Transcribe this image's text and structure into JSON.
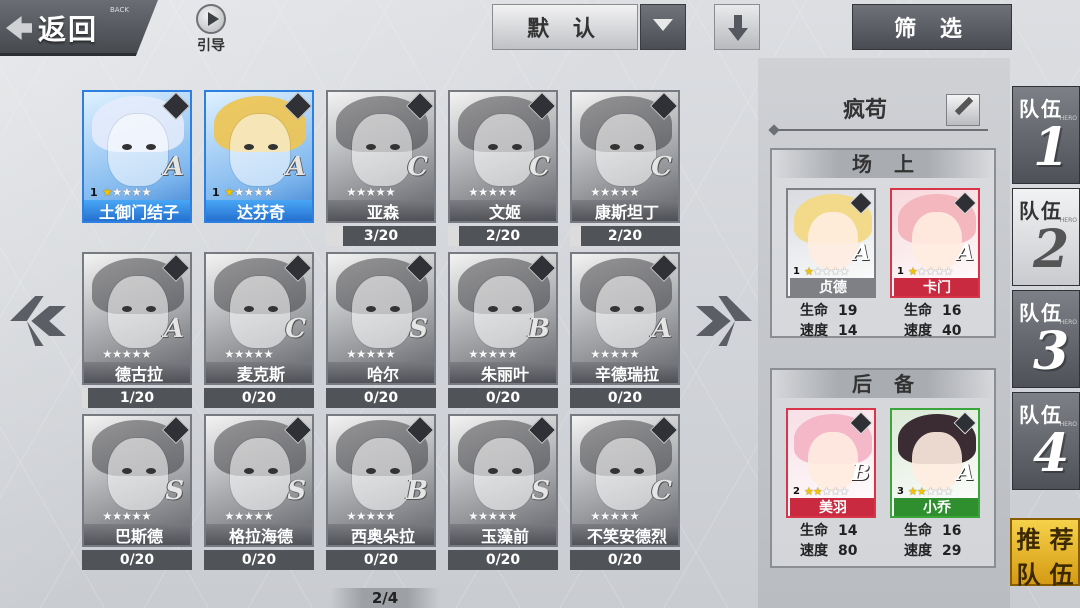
{
  "topbar": {
    "back_label": "返回",
    "back_sub": "BACK",
    "guide_label": "引导",
    "sort_label": "默 认",
    "filter_label": "筛 选"
  },
  "grid": {
    "page_indicator": "2/4",
    "cards": [
      {
        "name": "土御门结子",
        "level": "1",
        "stars": 1,
        "rank": "A",
        "owned": true,
        "hair": "silver",
        "fragments": ""
      },
      {
        "name": "达芬奇",
        "level": "1",
        "stars": 1,
        "rank": "A",
        "owned": true,
        "hair": "gold",
        "fragments": ""
      },
      {
        "name": "亚森",
        "level": "",
        "stars": 0,
        "rank": "C",
        "owned": false,
        "fragments": "3/20",
        "progress": 0.15
      },
      {
        "name": "文姬",
        "level": "",
        "stars": 0,
        "rank": "C",
        "owned": false,
        "fragments": "2/20",
        "progress": 0.1
      },
      {
        "name": "康斯坦丁",
        "level": "",
        "stars": 0,
        "rank": "C",
        "owned": false,
        "fragments": "2/20",
        "progress": 0.1
      },
      {
        "name": "德古拉",
        "level": "",
        "stars": 0,
        "rank": "A",
        "owned": false,
        "fragments": "1/20",
        "progress": 0.05
      },
      {
        "name": "麦克斯",
        "level": "",
        "stars": 0,
        "rank": "C",
        "owned": false,
        "fragments": "0/20",
        "progress": 0
      },
      {
        "name": "哈尔",
        "level": "",
        "stars": 0,
        "rank": "S",
        "owned": false,
        "fragments": "0/20",
        "progress": 0
      },
      {
        "name": "朱丽叶",
        "level": "",
        "stars": 0,
        "rank": "B",
        "owned": false,
        "fragments": "0/20",
        "progress": 0
      },
      {
        "name": "辛德瑞拉",
        "level": "",
        "stars": 0,
        "rank": "A",
        "owned": false,
        "fragments": "0/20",
        "progress": 0
      },
      {
        "name": "巴斯德",
        "level": "",
        "stars": 0,
        "rank": "S",
        "owned": false,
        "fragments": "0/20",
        "progress": 0
      },
      {
        "name": "格拉海德",
        "level": "",
        "stars": 0,
        "rank": "S",
        "owned": false,
        "fragments": "0/20",
        "progress": 0
      },
      {
        "name": "西奥朵拉",
        "level": "",
        "stars": 0,
        "rank": "B",
        "owned": false,
        "fragments": "0/20",
        "progress": 0
      },
      {
        "name": "玉藻前",
        "level": "",
        "stars": 0,
        "rank": "S",
        "owned": false,
        "fragments": "0/20",
        "progress": 0
      },
      {
        "name": "不笑安德烈",
        "level": "",
        "stars": 0,
        "rank": "C",
        "owned": false,
        "fragments": "0/20",
        "progress": 0
      }
    ]
  },
  "team": {
    "name": "疯苟",
    "field_title": "场上",
    "reserve_title": "后备",
    "hp_label": "生命",
    "speed_label": "速度",
    "field": [
      {
        "name": "贞德",
        "level": "1",
        "stars": 1,
        "rank": "A",
        "hp": "19",
        "speed": "14",
        "frame": "#7e8086",
        "hair": "#f2da8a",
        "bg": "#d9dbe0",
        "name_bg": "#7e8086"
      },
      {
        "name": "卡门",
        "level": "1",
        "stars": 1,
        "rank": "A",
        "hp": "16",
        "speed": "40",
        "frame": "#d8354a",
        "hair": "#f3b7bd",
        "bg": "#f7d8dc",
        "name_bg": "#c92a3f"
      }
    ],
    "reserve": [
      {
        "name": "美羽",
        "level": "2",
        "stars": 2,
        "rank": "B",
        "hp": "14",
        "speed": "80",
        "frame": "#d8354a",
        "hair": "#f4b8c8",
        "bg": "#f7dfe6",
        "name_bg": "#c92a3f"
      },
      {
        "name": "小乔",
        "level": "3",
        "stars": 2,
        "rank": "A",
        "hp": "16",
        "speed": "29",
        "frame": "#3aa53a",
        "hair": "#3b2c33",
        "bg": "#dbe9d6",
        "name_bg": "#2f8f2f"
      }
    ]
  },
  "tabs": [
    {
      "label": "队伍",
      "sub": "HERO",
      "num": "1",
      "active": false
    },
    {
      "label": "队伍",
      "sub": "HERO",
      "num": "2",
      "active": true
    },
    {
      "label": "队伍",
      "sub": "HERO",
      "num": "3",
      "active": false
    },
    {
      "label": "队伍",
      "sub": "HERO",
      "num": "4",
      "active": false
    }
  ],
  "recommend": [
    "推",
    "荐",
    "队",
    "伍"
  ]
}
